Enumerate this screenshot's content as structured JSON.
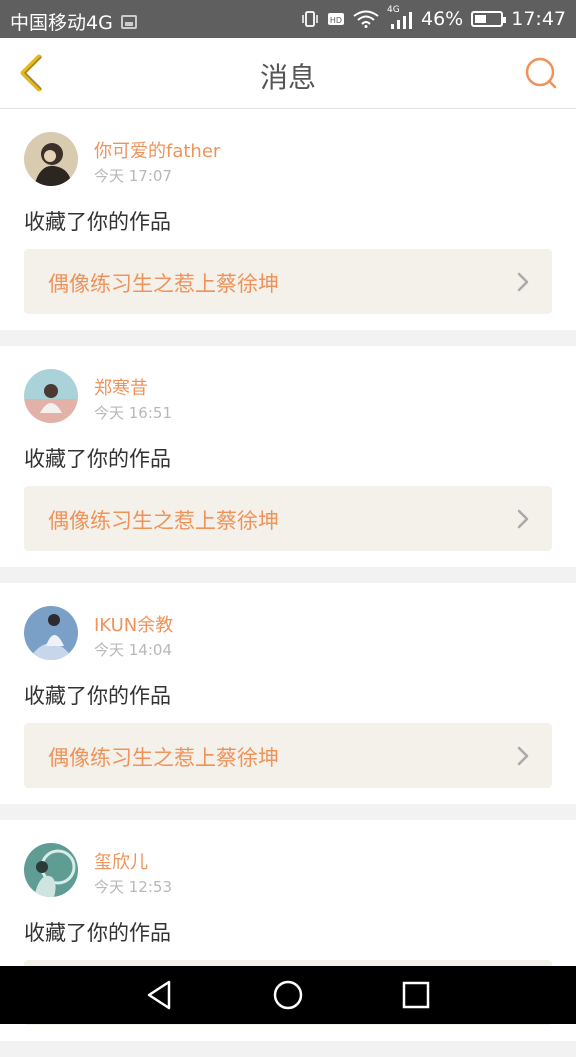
{
  "status_bar": {
    "carrier": "中国移动4G",
    "network": "4G",
    "battery": "46%",
    "time": "17:47"
  },
  "header": {
    "title": "消息",
    "back_icon": "back-chevron-icon",
    "search_icon": "search-icon"
  },
  "colors": {
    "accent": "#f0935b",
    "back_icon": "#e6b81e",
    "work_bg": "#f3f1ea"
  },
  "messages": [
    {
      "name": "你可爱的father",
      "time": "今天 17:07",
      "action": "收藏了你的作品",
      "work": "偶像练习生之惹上蔡徐坤"
    },
    {
      "name": "郑寒昔",
      "time": "今天 16:51",
      "action": "收藏了你的作品",
      "work": "偶像练习生之惹上蔡徐坤"
    },
    {
      "name": "IKUN余教",
      "time": "今天 14:04",
      "action": "收藏了你的作品",
      "work": "偶像练习生之惹上蔡徐坤"
    },
    {
      "name": "玺欣儿",
      "time": "今天 12:53",
      "action": "收藏了你的作品",
      "work": ""
    }
  ]
}
